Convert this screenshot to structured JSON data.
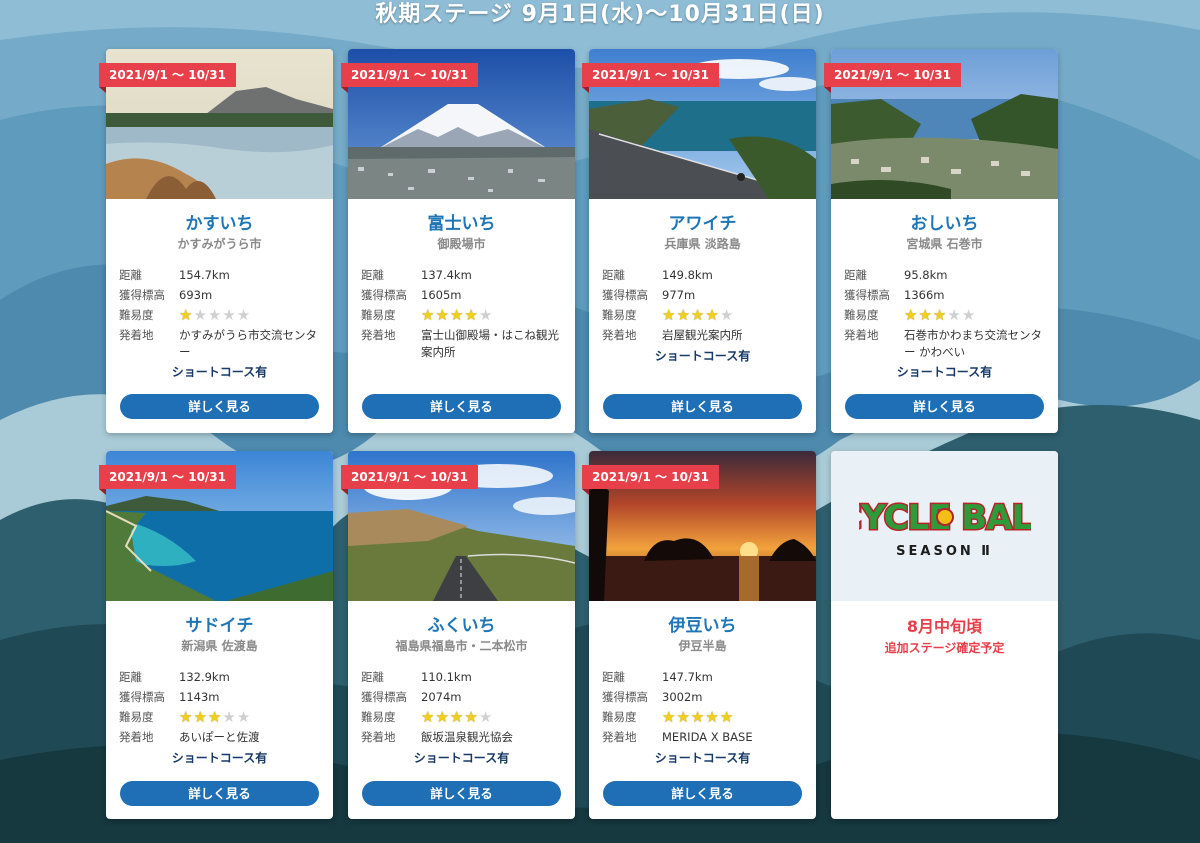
{
  "header": {
    "title": "秋期ステージ 9月1日(水)〜10月31日(日)"
  },
  "colors": {
    "accent_blue": "#1e76b7",
    "button_blue": "#1e6fb6",
    "tag_red": "#e8404a",
    "star_yellow": "#f2cf1a"
  },
  "labels": {
    "distance": "距離",
    "elevation": "獲得標高",
    "difficulty": "難易度",
    "start": "発着地",
    "detail_button": "詳しく見る"
  },
  "stages": [
    {
      "date": "2021/9/1 〜 10/31",
      "name": "かすいち",
      "area": "かすみがうら市",
      "distance": "154.7km",
      "elevation": "693m",
      "difficulty": 1,
      "start": "かすみがうら市交流センター",
      "short_course": "ショートコース有",
      "photo": "lake-mountain"
    },
    {
      "date": "2021/9/1 〜 10/31",
      "name": "富士いち",
      "area": "御殿場市",
      "distance": "137.4km",
      "elevation": "1605m",
      "difficulty": 4,
      "start": "富士山御殿場・はこね観光案内所",
      "short_course": "",
      "photo": "mount-fuji"
    },
    {
      "date": "2021/9/1 〜 10/31",
      "name": "アワイチ",
      "area": "兵庫県 淡路島",
      "distance": "149.8km",
      "elevation": "977m",
      "difficulty": 4,
      "start": "岩屋観光案内所",
      "short_course": "ショートコース有",
      "photo": "coastal-road"
    },
    {
      "date": "2021/9/1 〜 10/31",
      "name": "おしいち",
      "area": "宮城県 石巻市",
      "distance": "95.8km",
      "elevation": "1366m",
      "difficulty": 3,
      "start": "石巻市かわまち交流センター かわべい",
      "short_course": "ショートコース有",
      "photo": "bay-town"
    },
    {
      "date": "2021/9/1 〜 10/31",
      "name": "サドイチ",
      "area": "新潟県 佐渡島",
      "distance": "132.9km",
      "elevation": "1143m",
      "difficulty": 3,
      "start": "あいぽーと佐渡",
      "short_course": "ショートコース有",
      "photo": "turquoise-bay"
    },
    {
      "date": "2021/9/1 〜 10/31",
      "name": "ふくいち",
      "area": "福島県福島市・二本松市",
      "distance": "110.1km",
      "elevation": "2074m",
      "difficulty": 4,
      "start": "飯坂温泉観光協会",
      "short_course": "ショートコース有",
      "photo": "mountain-road"
    },
    {
      "date": "2021/9/1 〜 10/31",
      "name": "伊豆いち",
      "area": "伊豆半島",
      "distance": "147.7km",
      "elevation": "3002m",
      "difficulty": 5,
      "start": "MERIDA X BASE",
      "short_course": "ショートコース有",
      "photo": "sunset-sea"
    }
  ],
  "promo": {
    "logo_text": "CYCLE BALL",
    "season": "SEASON Ⅱ",
    "title": "8月中旬頃",
    "subtitle": "追加ステージ確定予定"
  }
}
